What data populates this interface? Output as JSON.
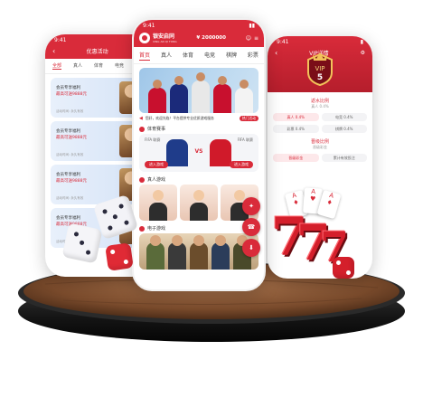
{
  "left_phone": {
    "time": "9:41",
    "title": "优惠活动",
    "tabs": [
      "全部",
      "真人",
      "体育",
      "电竞",
      "棋牌"
    ],
    "promos": [
      {
        "line1": "会员专享福利",
        "line2": "最高可送9888元",
        "foot": "活动时间: 永久有效"
      },
      {
        "line1": "会员专享福利",
        "line2": "最高可送9888元",
        "foot": "活动时间: 永久有效"
      },
      {
        "line1": "会员专享福利",
        "line2": "最高可送9888元",
        "foot": "活动时间: 永久有效"
      },
      {
        "line1": "会员专享福利",
        "line2": "最高可送9888元",
        "foot": "活动时间: 永久有效"
      }
    ]
  },
  "center_phone": {
    "time": "9:41",
    "logo_text": "银安启同",
    "logo_sub": "XING AN QI TONG",
    "balance": "¥ 2000000",
    "nav": [
      "首页",
      "真人",
      "体育",
      "电竞",
      "棋牌",
      "彩票"
    ],
    "notice": "您好，欢迎光临！平台提供专业优质游戏服务",
    "hot_label": "热门活动",
    "sports_section": "体育赛事",
    "league_left": "FIFA 联赛",
    "league_right": "FIFA 联赛",
    "vs": "VS",
    "enter_left": "进入游戏",
    "enter_right": "进入游戏",
    "live_section": "真人游戏",
    "egame_section": "电子游戏"
  },
  "right_phone": {
    "time": "9:41",
    "title": "VIP详情",
    "vip_level": "VIP",
    "vip_number": "5",
    "rebate_title": "返水比例",
    "rebate_hint": "真人 0.4%",
    "upgrade_title": "晋级比例",
    "upgrade_hint": "晋级彩金",
    "pills_row1": [
      "真人 0.4%",
      "电竞 0.4%"
    ],
    "pills_row2": [
      "彩票 0.4%",
      "棋牌 0.4%"
    ],
    "pills_row3": [
      "晋级彩金",
      "累计有效投注"
    ]
  },
  "colors": {
    "brand_red": "#d92b3a",
    "wood": "#8a5a3a"
  }
}
